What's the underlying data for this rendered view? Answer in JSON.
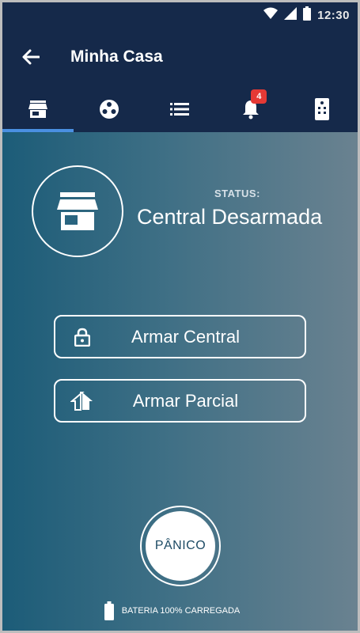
{
  "statusbar": {
    "time": "12:30"
  },
  "appbar": {
    "title": "Minha Casa",
    "back_icon": "arrow-left-icon"
  },
  "tabs": [
    {
      "icon": "store-icon",
      "active": true
    },
    {
      "icon": "zones-icon",
      "active": false
    },
    {
      "icon": "list-icon",
      "active": false
    },
    {
      "icon": "bell-icon",
      "active": false,
      "badge": "4"
    },
    {
      "icon": "remote-icon",
      "active": false
    }
  ],
  "status": {
    "label": "STATUS:",
    "value": "Central Desarmada",
    "icon": "store-icon"
  },
  "actions": {
    "arm_full": {
      "label": "Armar Central",
      "icon": "lock-icon"
    },
    "arm_partial": {
      "label": "Armar Parcial",
      "icon": "home-partial-icon"
    }
  },
  "panic": {
    "label": "PÂNICO"
  },
  "battery": {
    "label": "BATERIA 100% CARREGADA",
    "icon": "battery-icon"
  },
  "colors": {
    "header": "#15294a",
    "accent_tab": "#4a90e2",
    "badge": "#e53935"
  }
}
